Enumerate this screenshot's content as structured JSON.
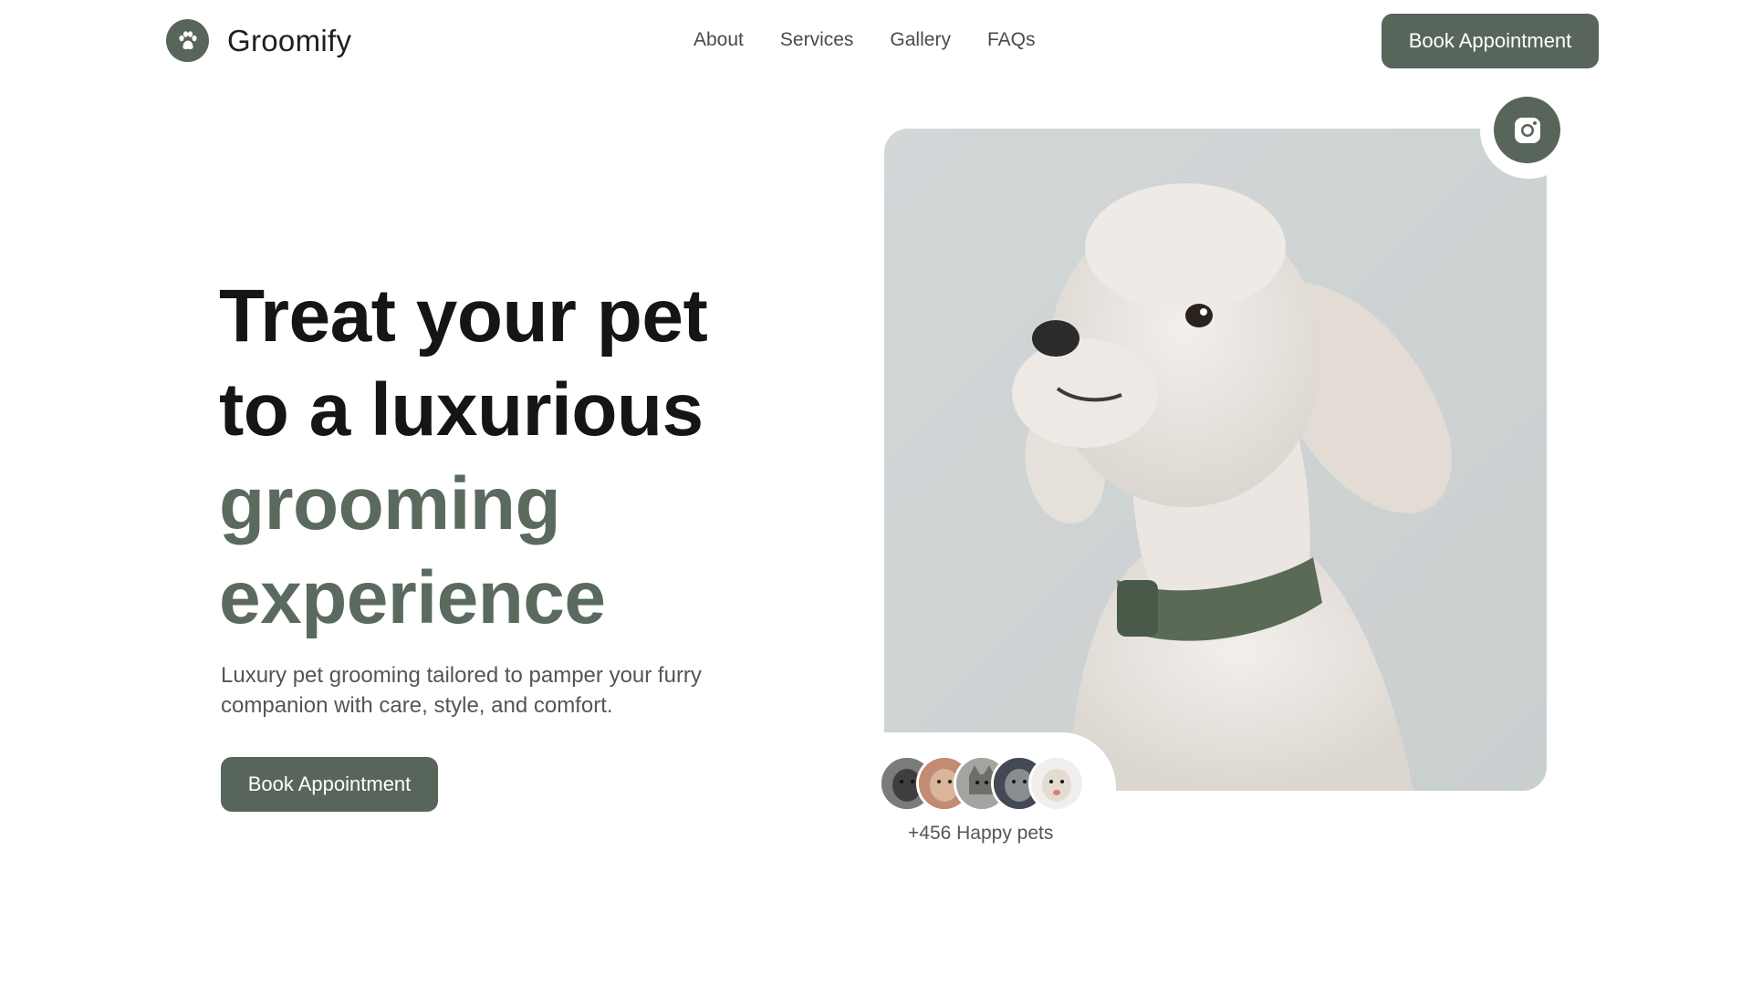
{
  "brand": {
    "name": "Groomify",
    "logo_icon": "paw-icon"
  },
  "nav": {
    "items": [
      {
        "label": "About"
      },
      {
        "label": "Services"
      },
      {
        "label": "Gallery"
      },
      {
        "label": "FAQs"
      }
    ]
  },
  "header": {
    "cta_label": "Book Appointment"
  },
  "hero": {
    "title_line1": "Treat your pet",
    "title_line2": "to a luxurious",
    "title_line3": "grooming",
    "title_line4": "experience",
    "subtitle": "Luxury pet grooming tailored to pamper your furry companion with care, style, and comfort.",
    "cta_label": "Book Appointment",
    "image_subject": "poodle with green collar"
  },
  "social": {
    "icon": "instagram-icon"
  },
  "happy_pets": {
    "label": "+456 Happy pets",
    "avatars": [
      "dog-avatar",
      "dog-avatar",
      "cat-avatar",
      "dog-avatar",
      "dog-avatar"
    ]
  },
  "colors": {
    "accent": "#58655a",
    "accent_text": "#5b6a5e",
    "text_dark": "#151515",
    "text_muted": "#555555",
    "photo_bg": "#d3d7d8"
  }
}
